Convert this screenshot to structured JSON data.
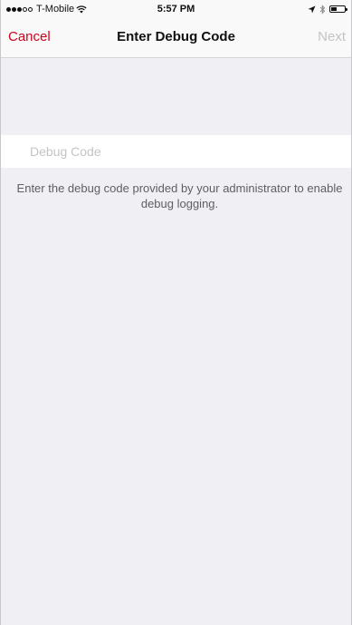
{
  "status_bar": {
    "carrier": "T-Mobile",
    "time": "5:57 PM",
    "signal_bars_filled": 3,
    "signal_bars_total": 5,
    "battery_level": 0.4
  },
  "nav": {
    "cancel_label": "Cancel",
    "title": "Enter Debug Code",
    "next_label": "Next"
  },
  "form": {
    "debug_code_value": "",
    "debug_code_placeholder": "Debug Code",
    "help_text": "Enter the debug code provided by your administrator to enable debug logging."
  },
  "colors": {
    "accent": "#d0021b",
    "disabled": "#c4c4c8",
    "background": "#efeff4"
  }
}
